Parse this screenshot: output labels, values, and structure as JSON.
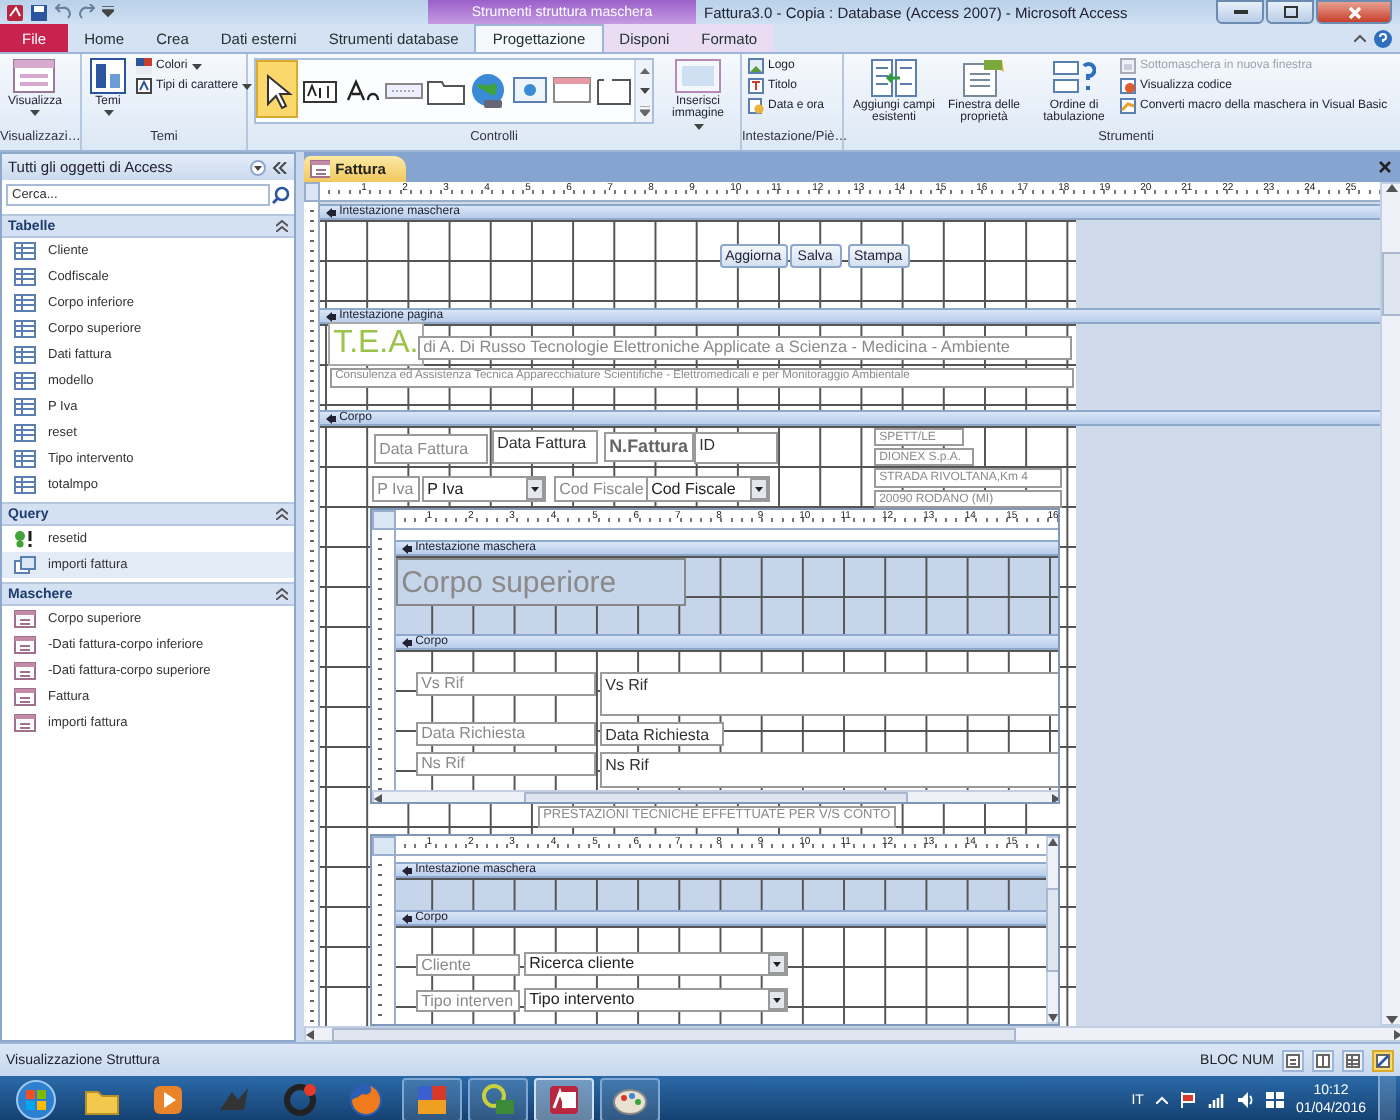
{
  "window": {
    "title": "Fattura3.0 - Copia : Database (Access 2007) - Microsoft Access",
    "context_group": "Strumenti struttura maschera"
  },
  "ribbon_tabs": [
    {
      "label": "File",
      "kind": "file",
      "selected": false
    },
    {
      "label": "Home",
      "kind": "tab",
      "selected": false
    },
    {
      "label": "Crea",
      "kind": "tab",
      "selected": false
    },
    {
      "label": "Dati esterni",
      "kind": "tab",
      "selected": false
    },
    {
      "label": "Strumenti database",
      "kind": "tab",
      "selected": false
    },
    {
      "label": "Progettazione",
      "kind": "context",
      "selected": true
    },
    {
      "label": "Disponi",
      "kind": "context",
      "selected": false
    },
    {
      "label": "Formato",
      "kind": "context",
      "selected": false
    }
  ],
  "ribbon_groups": [
    {
      "label": "Visualizzazi…",
      "items": [
        {
          "kind": "large",
          "label": "Visualizza",
          "dropdown": true,
          "disabled": false
        }
      ]
    },
    {
      "label": "Temi",
      "items": [
        {
          "kind": "large",
          "label": "Temi",
          "dropdown": true,
          "disabled": false
        },
        {
          "kind": "small",
          "label": "Colori",
          "dropdown": true,
          "disabled": false
        },
        {
          "kind": "small",
          "label": "Tipi di carattere",
          "dropdown": true,
          "disabled": false
        }
      ]
    },
    {
      "label": "Controlli",
      "items": [
        {
          "kind": "gallery",
          "tools": [
            {
              "kind": "pointer",
              "selected": true
            },
            {
              "kind": "textbox",
              "selected": false
            },
            {
              "kind": "label",
              "selected": false
            },
            {
              "kind": "button",
              "selected": false
            },
            {
              "kind": "tab",
              "selected": false
            },
            {
              "kind": "hyperlink",
              "selected": false
            },
            {
              "kind": "browser",
              "selected": false
            },
            {
              "kind": "navigation",
              "selected": false
            },
            {
              "kind": "group",
              "selected": false
            }
          ]
        },
        {
          "kind": "large",
          "label": "Inserisci immagine",
          "dropdown": true,
          "disabled": false
        }
      ]
    },
    {
      "label": "Intestazione/Piè…",
      "items": [
        {
          "kind": "small",
          "label": "Logo",
          "dropdown": false,
          "disabled": false
        },
        {
          "kind": "small",
          "label": "Titolo",
          "dropdown": false,
          "disabled": false
        },
        {
          "kind": "small",
          "label": "Data e ora",
          "dropdown": false,
          "disabled": false
        }
      ]
    },
    {
      "label": "Strumenti",
      "items": [
        {
          "kind": "large",
          "label": "Aggiungi campi esistenti",
          "dropdown": false,
          "disabled": false
        },
        {
          "kind": "large",
          "label": "Finestra delle proprietà",
          "dropdown": false,
          "disabled": false
        },
        {
          "kind": "large",
          "label": "Ordine di tabulazione",
          "dropdown": false,
          "disabled": false
        },
        {
          "kind": "small",
          "label": "Sottomaschera in nuova finestra",
          "dropdown": false,
          "disabled": true
        },
        {
          "kind": "small",
          "label": "Visualizza codice",
          "dropdown": false,
          "disabled": false
        },
        {
          "kind": "small",
          "label": "Converti macro della maschera in Visual Basic",
          "dropdown": false,
          "disabled": false
        }
      ]
    }
  ],
  "navigation_pane": {
    "title": "Tutti gli oggetti di Access",
    "search": {
      "placeholder": "Cerca..."
    },
    "groups": [
      {
        "label": "Tabelle",
        "items": [
          {
            "label": "Cliente",
            "kind": "table",
            "selected": false
          },
          {
            "label": "Codfiscale",
            "kind": "table",
            "selected": false
          },
          {
            "label": "Corpo inferiore",
            "kind": "table",
            "selected": false
          },
          {
            "label": "Corpo superiore",
            "kind": "table",
            "selected": false
          },
          {
            "label": "Dati fattura",
            "kind": "table",
            "selected": false
          },
          {
            "label": "modello",
            "kind": "table",
            "selected": false
          },
          {
            "label": "P Iva",
            "kind": "table",
            "selected": false
          },
          {
            "label": "reset",
            "kind": "table",
            "selected": false
          },
          {
            "label": "Tipo intervento",
            "kind": "table",
            "selected": false
          },
          {
            "label": "totalmpo",
            "kind": "table",
            "selected": false
          }
        ]
      },
      {
        "label": "Query",
        "items": [
          {
            "label": "resetid",
            "kind": "action-query",
            "selected": false
          },
          {
            "label": "importi fattura",
            "kind": "select-query",
            "selected": true
          }
        ]
      },
      {
        "label": "Maschere",
        "items": [
          {
            "label": "Corpo superiore",
            "kind": "form",
            "selected": false
          },
          {
            "label": "-Dati fattura-corpo inferiore",
            "kind": "form",
            "selected": false
          },
          {
            "label": "-Dati fattura-corpo superiore",
            "kind": "form",
            "selected": false
          },
          {
            "label": "Fattura",
            "kind": "form",
            "selected": false
          },
          {
            "label": "importi fattura",
            "kind": "form",
            "selected": false
          }
        ]
      }
    ]
  },
  "document": {
    "tab": {
      "label": "Fattura",
      "selected": true
    },
    "form": {
      "ruler": [
        "1",
        "2",
        "3",
        "4",
        "5",
        "6",
        "7",
        "8",
        "9",
        "10",
        "11",
        "12",
        "13",
        "14",
        "15",
        "16",
        "17",
        "18",
        "19",
        "20",
        "21",
        "22",
        "23",
        "24",
        "25"
      ],
      "sections": [
        {
          "title": "Intestazione maschera",
          "controls": [
            {
              "kind": "button",
              "text": "Aggiorna"
            },
            {
              "kind": "button",
              "text": "Salva"
            },
            {
              "kind": "button",
              "text": "Stampa"
            }
          ]
        },
        {
          "title": "Intestazione pagina",
          "controls": [
            {
              "kind": "title",
              "text": "T.E.A."
            },
            {
              "kind": "label",
              "text": "di A. Di Russo Tecnologie Elettroniche Applicate a Scienza - Medicina - Ambiente"
            },
            {
              "kind": "label",
              "text": "Consulenza ed Assistenza Tecnica Apparecchiature Scientifiche - Elettromedicali e per Monitoraggio Ambientale"
            }
          ]
        },
        {
          "title": "Corpo",
          "controls": [
            {
              "kind": "label",
              "text": "Data Fattura"
            },
            {
              "kind": "textbox",
              "text": "Data Fattura"
            },
            {
              "kind": "label-bold",
              "text": "N.Fattura"
            },
            {
              "kind": "textbox",
              "text": "ID"
            },
            {
              "kind": "label",
              "text": "P Iva"
            },
            {
              "kind": "combo",
              "text": "P Iva"
            },
            {
              "kind": "label",
              "text": "Cod Fiscale"
            },
            {
              "kind": "combo",
              "text": "Cod Fiscale"
            },
            {
              "kind": "label",
              "text": "SPETT/LE"
            },
            {
              "kind": "label",
              "text": "DIONEX S.p.A."
            },
            {
              "kind": "label",
              "text": "STRADA RIVOLTANA,Km 4"
            },
            {
              "kind": "label",
              "text": "20090 RODANO (MI)"
            },
            {
              "kind": "subform",
              "ruler": [
                "1",
                "2",
                "3",
                "4",
                "5",
                "6",
                "7",
                "8",
                "9",
                "10",
                "11",
                "12",
                "13",
                "14",
                "15",
                "16"
              ],
              "sections": [
                {
                  "title": "Intestazione maschera",
                  "controls": [
                    {
                      "kind": "heading",
                      "text": "Corpo superiore"
                    }
                  ]
                },
                {
                  "title": "Corpo",
                  "controls": [
                    {
                      "kind": "label",
                      "text": "Vs Rif"
                    },
                    {
                      "kind": "textbox",
                      "text": "Vs Rif"
                    },
                    {
                      "kind": "label",
                      "text": "Data Richiesta"
                    },
                    {
                      "kind": "textbox",
                      "text": "Data Richiesta"
                    },
                    {
                      "kind": "label",
                      "text": "Ns Rif"
                    },
                    {
                      "kind": "textbox",
                      "text": "Ns Rif"
                    }
                  ]
                }
              ]
            },
            {
              "kind": "label",
              "text": "PRESTAZIONI TECNICHE EFFETTUATE PER V/S CONTO"
            },
            {
              "kind": "subform",
              "ruler": [
                "1",
                "2",
                "3",
                "4",
                "5",
                "6",
                "7",
                "8",
                "9",
                "10",
                "11",
                "12",
                "13",
                "14",
                "15"
              ],
              "sections": [
                {
                  "title": "Intestazione maschera"
                },
                {
                  "title": "Corpo",
                  "controls": [
                    {
                      "kind": "label",
                      "text": "Cliente"
                    },
                    {
                      "kind": "combo",
                      "text": "Ricerca cliente"
                    },
                    {
                      "kind": "label",
                      "text": "Tipo interven"
                    },
                    {
                      "kind": "combo",
                      "text": "Tipo intervento"
                    }
                  ]
                }
              ]
            }
          ]
        }
      ]
    }
  },
  "status_bar": {
    "text": "Visualizzazione Struttura",
    "indicator": "BLOC NUM",
    "view_buttons": [
      {
        "kind": "form",
        "selected": false
      },
      {
        "kind": "layout",
        "selected": false
      },
      {
        "kind": "datasheet",
        "selected": false
      },
      {
        "kind": "design",
        "selected": true
      }
    ]
  },
  "taskbar": {
    "apps": [
      {
        "kind": "explorer",
        "running": false,
        "selected": false
      },
      {
        "kind": "media",
        "running": false,
        "selected": false
      },
      {
        "kind": "tool",
        "running": false,
        "selected": false
      },
      {
        "kind": "cleaner",
        "running": false,
        "selected": false
      },
      {
        "kind": "firefox",
        "running": false,
        "selected": false
      },
      {
        "kind": "multimedia",
        "running": true,
        "selected": false
      },
      {
        "kind": "network",
        "running": true,
        "selected": false
      },
      {
        "kind": "access",
        "running": true,
        "selected": true
      },
      {
        "kind": "paint",
        "running": true,
        "selected": false
      }
    ],
    "language": "IT",
    "time": "10:12",
    "date": "01/04/2016"
  }
}
